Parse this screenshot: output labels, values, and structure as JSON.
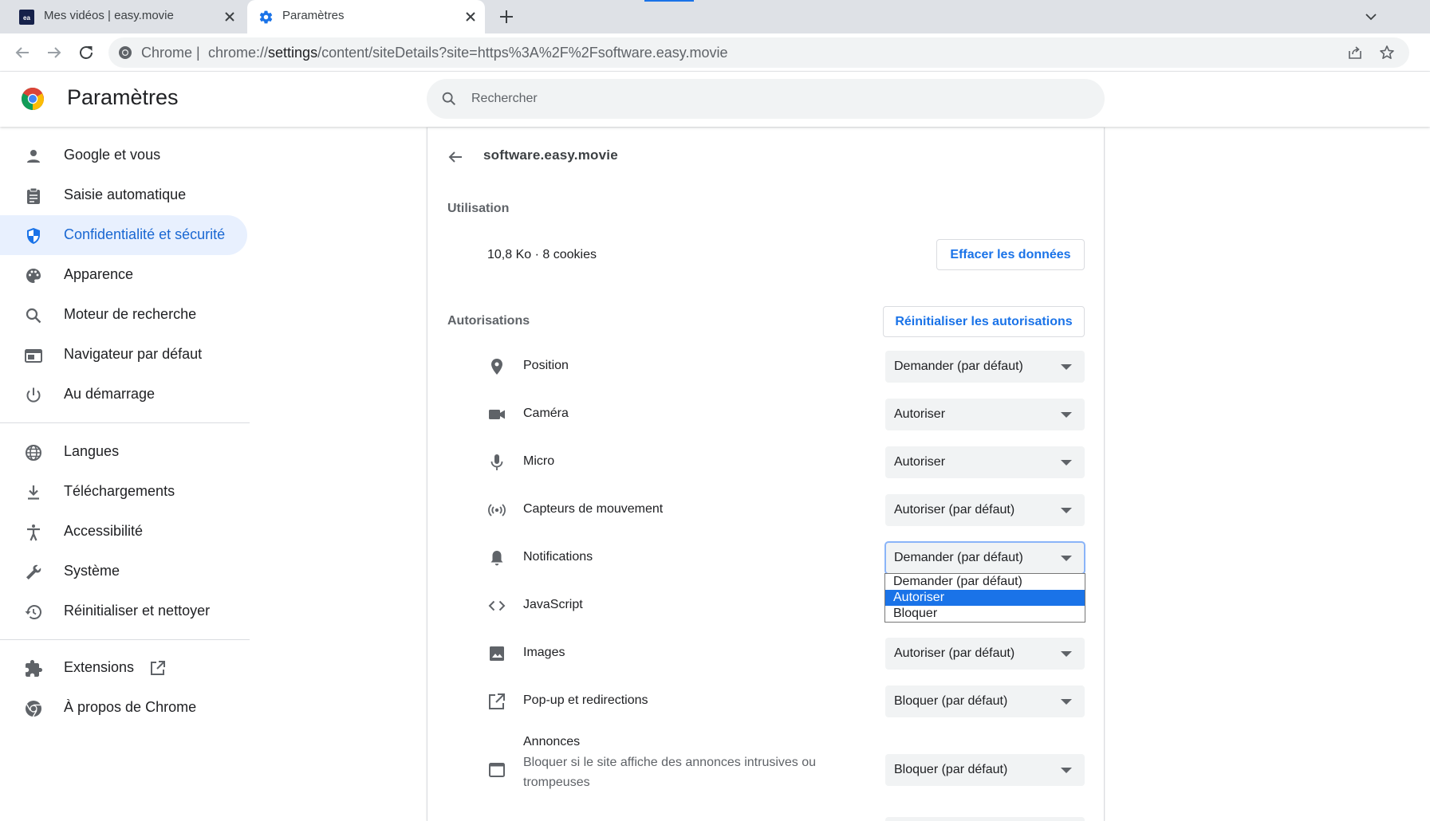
{
  "browser": {
    "tabs": [
      {
        "title": "Mes vidéos | easy.movie",
        "favicon": "easy-movie-favicon"
      },
      {
        "title": "Paramètres",
        "favicon": "gear-icon"
      }
    ],
    "omnibox": {
      "chip": "Chrome",
      "separator": "|",
      "url_prefix": "chrome://",
      "url_host": "settings",
      "url_path": "/content/siteDetails?site=https%3A%2F%2Fsoftware.easy.movie"
    }
  },
  "settings_header": {
    "title": "Paramètres",
    "search_placeholder": "Rechercher"
  },
  "sidebar": {
    "items": [
      {
        "label": "Google et vous",
        "icon": "person-icon"
      },
      {
        "label": "Saisie automatique",
        "icon": "clipboard-icon"
      },
      {
        "label": "Confidentialité et sécurité",
        "icon": "shield-icon",
        "selected": true
      },
      {
        "label": "Apparence",
        "icon": "palette-icon"
      },
      {
        "label": "Moteur de recherche",
        "icon": "search-icon"
      },
      {
        "label": "Navigateur par défaut",
        "icon": "browser-window-icon"
      },
      {
        "label": "Au démarrage",
        "icon": "power-icon"
      },
      {
        "label": "Langues",
        "icon": "globe-icon"
      },
      {
        "label": "Téléchargements",
        "icon": "download-icon"
      },
      {
        "label": "Accessibilité",
        "icon": "accessibility-icon"
      },
      {
        "label": "Système",
        "icon": "wrench-icon"
      },
      {
        "label": "Réinitialiser et nettoyer",
        "icon": "restore-icon"
      },
      {
        "label": "Extensions",
        "icon": "puzzle-icon"
      },
      {
        "label": "À propos de Chrome",
        "icon": "chrome-icon"
      }
    ]
  },
  "site_details": {
    "site": "software.easy.movie",
    "usage": {
      "heading": "Utilisation",
      "text": "10,8 Ko · 8 cookies",
      "clear_button": "Effacer les données"
    },
    "permissions": {
      "heading": "Autorisations",
      "reset_button": "Réinitialiser les autorisations",
      "rows": [
        {
          "label": "Position",
          "value": "Demander (par défaut)",
          "icon": "location-pin-icon"
        },
        {
          "label": "Caméra",
          "value": "Autoriser",
          "icon": "camera-icon"
        },
        {
          "label": "Micro",
          "value": "Autoriser",
          "icon": "microphone-icon"
        },
        {
          "label": "Capteurs de mouvement",
          "value": "Autoriser (par défaut)",
          "icon": "sensors-icon"
        },
        {
          "label": "Notifications",
          "value": "Demander (par défaut)",
          "icon": "bell-icon"
        },
        {
          "label": "JavaScript",
          "value": "",
          "icon": "code-icon"
        },
        {
          "label": "Images",
          "value": "Autoriser (par défaut)",
          "icon": "image-icon"
        },
        {
          "label": "Pop-up et redirections",
          "value": "Bloquer (par défaut)",
          "icon": "open-external-icon"
        },
        {
          "label": "Annonces",
          "sublabel": "Bloquer si le site affiche des annonces intrusives ou trompeuses",
          "value": "Bloquer (par défaut)",
          "icon": "ads-window-icon"
        }
      ],
      "open_dropdown": {
        "for": "Notifications",
        "options": [
          "Demander (par défaut)",
          "Autoriser",
          "Bloquer"
        ],
        "highlighted": "Autoriser"
      }
    }
  },
  "colors": {
    "accent": "#1a73e8",
    "selected_nav_bg": "#e8f0fe",
    "selected_nav_text": "#1967d2"
  }
}
